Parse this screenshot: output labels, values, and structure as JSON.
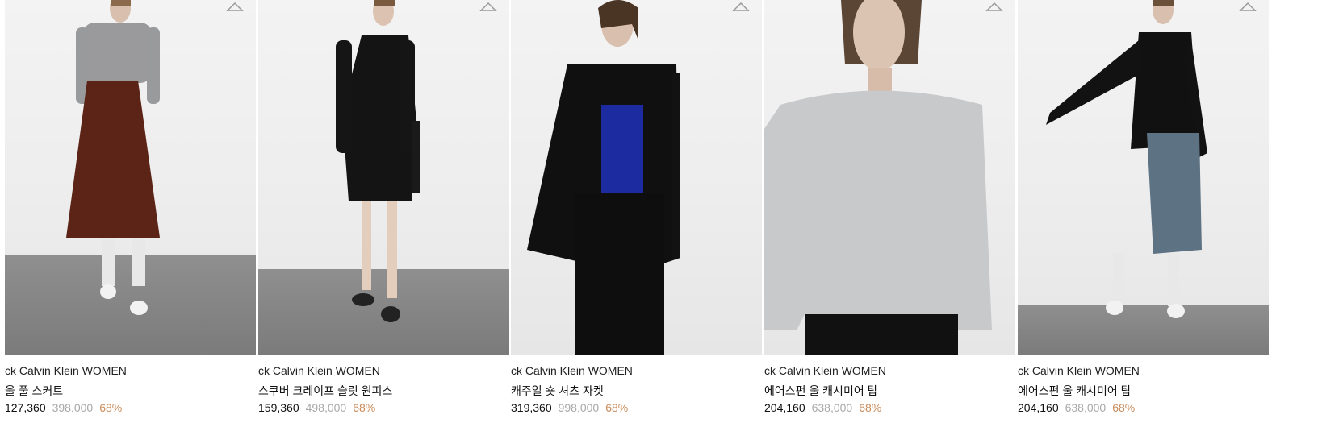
{
  "products": [
    {
      "brand": "ck Calvin Klein WOMEN",
      "name": "울 풀 스커트",
      "price": "127,360",
      "original_price": "398,000",
      "discount": "68%"
    },
    {
      "brand": "ck Calvin Klein WOMEN",
      "name": "스쿠버 크레이프 슬릿 원피스",
      "price": "159,360",
      "original_price": "498,000",
      "discount": "68%"
    },
    {
      "brand": "ck Calvin Klein WOMEN",
      "name": "캐주얼 숏 셔츠 자켓",
      "price": "319,360",
      "original_price": "998,000",
      "discount": "68%"
    },
    {
      "brand": "ck Calvin Klein WOMEN",
      "name": "에어스펀 울 캐시미어 탑",
      "price": "204,160",
      "original_price": "638,000",
      "discount": "68%"
    },
    {
      "brand": "ck Calvin Klein WOMEN",
      "name": "에어스펀 울 캐시미어 탑",
      "price": "204,160",
      "original_price": "638,000",
      "discount": "68%"
    }
  ],
  "colors": {
    "price": "#111111",
    "original_price": "#a8a8a8",
    "discount": "#c98c5b",
    "wishlist_icon": "#9a9a9a"
  },
  "icons": {
    "wishlist": "heart-outline-icon"
  }
}
